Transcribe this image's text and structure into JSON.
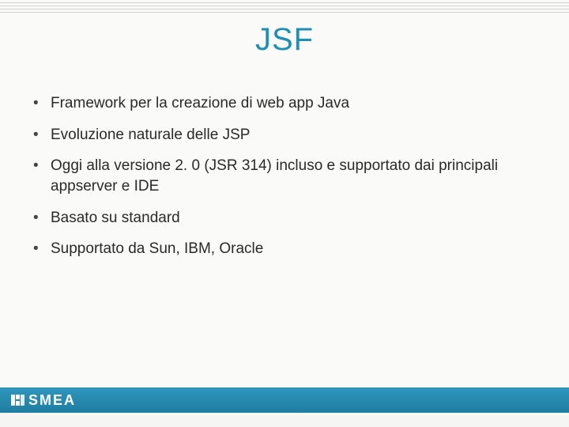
{
  "slide": {
    "title": "JSF",
    "bullets": [
      "Framework per la creazione di web app Java",
      "Evoluzione naturale delle JSP",
      "Oggi alla versione 2. 0 (JSR 314) incluso e supportato dai principali appserver e IDE",
      "Basato su standard",
      "Supportato da Sun, IBM, Oracle"
    ]
  },
  "footer": {
    "brand": "SMEA"
  }
}
